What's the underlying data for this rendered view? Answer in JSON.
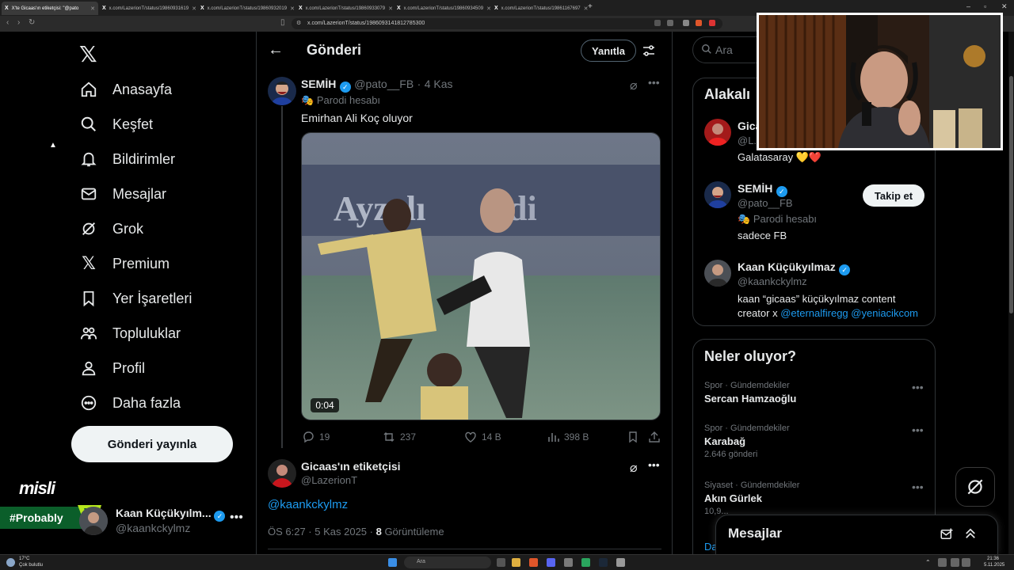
{
  "browser": {
    "tabs": [
      {
        "title": "X'te Gicaas'ın etiketçisi: \"@pato",
        "active": true
      },
      {
        "title": "x.com/LazerionT/status/19860931619",
        "active": false
      },
      {
        "title": "x.com/LazerionT/status/19860932019",
        "active": false
      },
      {
        "title": "x.com/LazerionT/status/19860933079",
        "active": false
      },
      {
        "title": "x.com/LazerionT/status/19860934509",
        "active": false
      },
      {
        "title": "x.com/LazerionT/status/19861167697",
        "active": false
      }
    ],
    "url": "x.com/LazerionT/status/1986093141812785300"
  },
  "sidebar": {
    "items": [
      {
        "label": "Anasayfa",
        "icon": "home-icon"
      },
      {
        "label": "Keşfet",
        "icon": "search-icon"
      },
      {
        "label": "Bildirimler",
        "icon": "bell-icon"
      },
      {
        "label": "Mesajlar",
        "icon": "mail-icon"
      },
      {
        "label": "Grok",
        "icon": "grok-icon"
      },
      {
        "label": "Premium",
        "icon": "x-icon"
      },
      {
        "label": "Yer İşaretleri",
        "icon": "bookmark-icon"
      },
      {
        "label": "Topluluklar",
        "icon": "communities-icon"
      },
      {
        "label": "Profil",
        "icon": "profile-icon"
      },
      {
        "label": "Daha fazla",
        "icon": "more-icon"
      }
    ],
    "post_button": "Gönderi yayınla",
    "account": {
      "name": "Kaan Küçükyılm...",
      "handle": "@kaankckylmz"
    }
  },
  "overlay": {
    "misli": "misli",
    "probably": "#Probably"
  },
  "header": {
    "title": "Gönderi",
    "reply_button": "Yanıtla"
  },
  "quoted_tweet": {
    "name": "SEMİH",
    "handle": "@pato__FB",
    "time": "4 Kas",
    "badge": "Parodi hesabı",
    "text": "Emirhan Ali Koç oluyor",
    "video_duration": "0:04",
    "replies": "19",
    "retweets": "237",
    "likes": "14 B",
    "views": "398 B"
  },
  "main_tweet": {
    "name": "Gicaas'ın etiketçisi",
    "handle": "@LazerionT",
    "text": "@kaankckylmz",
    "timestamp": "ÖS 6:27 · 5 Kas 2025 · ",
    "views_count": "8",
    "views_label": "Görüntüleme"
  },
  "search": {
    "placeholder": "Ara"
  },
  "related": {
    "title": "Alakalı",
    "people": [
      {
        "name": "Gica...",
        "handle": "@L...",
        "bio": "Galatasaray 💛❤️"
      },
      {
        "name": "SEMİH",
        "handle": "@pato__FB",
        "badge": "Parodi hesabı",
        "bio": "sadece FB",
        "follow": "Takip et"
      },
      {
        "name": "Kaan Küçükyılmaz",
        "handle": "@kaankckylmz",
        "bio_line1": "kaan “gicaas” küçükyılmaz content",
        "bio_line2_prefix": "creator x ",
        "bio_link1": "@eternalfiregg",
        "bio_link2": "@yeniacikcom"
      }
    ]
  },
  "trends": {
    "title": "Neler oluyor?",
    "items": [
      {
        "meta": "Spor · Gündemdekiler",
        "name": "Sercan Hamzaoğlu",
        "count": ""
      },
      {
        "meta": "Spor · Gündemdekiler",
        "name": "Karabağ",
        "count": "2.646 gönderi"
      },
      {
        "meta": "Siyaset · Gündemdekiler",
        "name": "Akın Gürlek",
        "count": "10,9..."
      }
    ],
    "more_link": "Da"
  },
  "messages_drawer": {
    "title": "Mesajlar"
  },
  "taskbar": {
    "weather_temp": "17°C",
    "weather_desc": "Çok bulutlu",
    "search": "Ara",
    "time": "21:36",
    "date": "5.11.2025"
  }
}
